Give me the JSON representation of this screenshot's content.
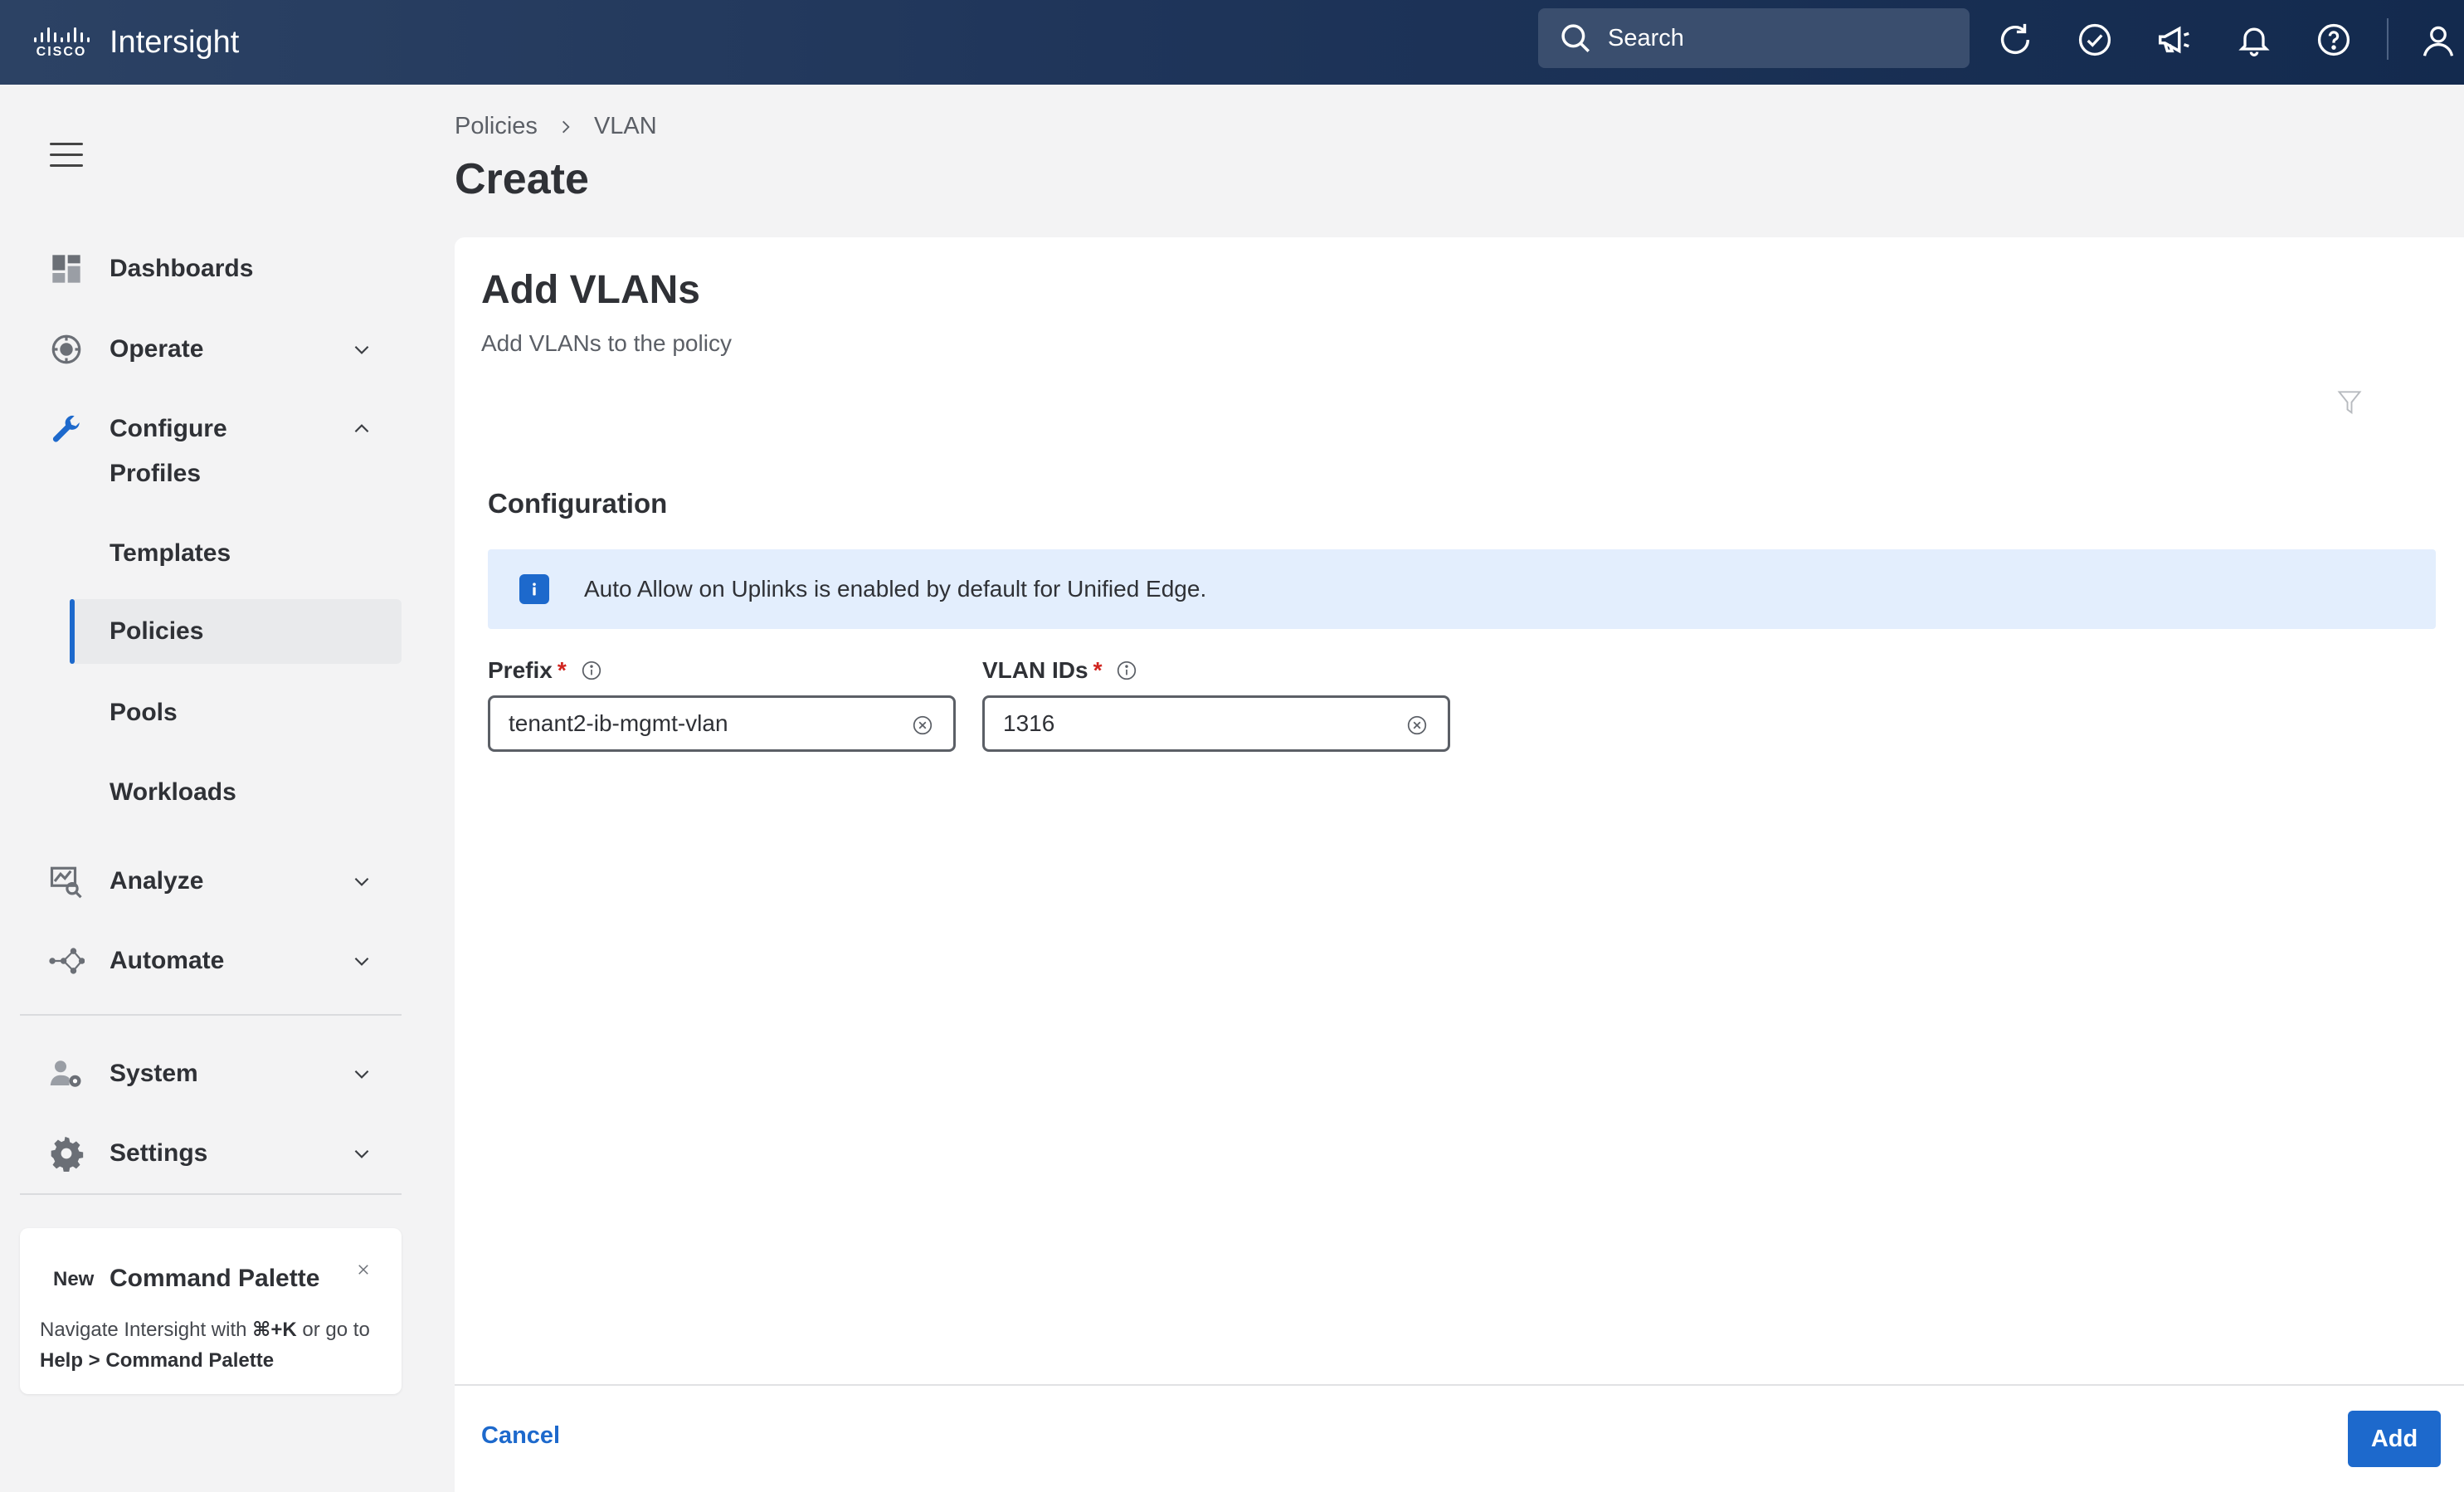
{
  "header": {
    "brand_word": "CISCO",
    "app_title": "Intersight",
    "search_placeholder": "Search",
    "icons": [
      "refresh-icon",
      "check-circle-icon",
      "megaphone-icon",
      "bell-icon",
      "help-icon",
      "user-icon"
    ]
  },
  "sidebar": {
    "items": [
      {
        "label": "Dashboards",
        "icon": "dashboard-icon"
      },
      {
        "label": "Operate",
        "icon": "operate-icon",
        "expanded": false
      },
      {
        "label": "Configure",
        "icon": "wrench-icon",
        "expanded": true
      },
      {
        "label": "Analyze",
        "icon": "analyze-icon",
        "expanded": false
      },
      {
        "label": "Automate",
        "icon": "automate-icon",
        "expanded": false
      },
      {
        "label": "System",
        "icon": "system-icon",
        "expanded": false
      },
      {
        "label": "Settings",
        "icon": "gear-icon",
        "expanded": false
      }
    ],
    "configure_children": [
      "Profiles",
      "Templates",
      "Policies",
      "Pools",
      "Workloads"
    ],
    "active_child": "Policies",
    "command_palette": {
      "badge": "New",
      "title": "Command Palette",
      "text_prefix": "Navigate Intersight with ",
      "shortcut": "⌘+K",
      "text_middle": " or go to ",
      "path": "Help > Command Palette"
    }
  },
  "breadcrumb": {
    "items": [
      "Policies",
      "VLAN"
    ]
  },
  "page": {
    "title": "Create"
  },
  "panel": {
    "title": "Add VLANs",
    "subtitle": "Add VLANs to the policy",
    "section_title": "Configuration",
    "info_text": "Auto Allow on Uplinks is enabled by default for Unified Edge.",
    "fields": {
      "prefix": {
        "label": "Prefix",
        "required": "*",
        "value": "tenant2-ib-mgmt-vlan"
      },
      "vlan_ids": {
        "label": "VLAN IDs",
        "required": "*",
        "value": "1316"
      }
    },
    "cancel_label": "Cancel",
    "add_label": "Add"
  },
  "colors": {
    "accent": "#1d69cc",
    "header_bg": "#1f355a",
    "info_bg": "#e3eefd",
    "required": "#d0241f"
  }
}
